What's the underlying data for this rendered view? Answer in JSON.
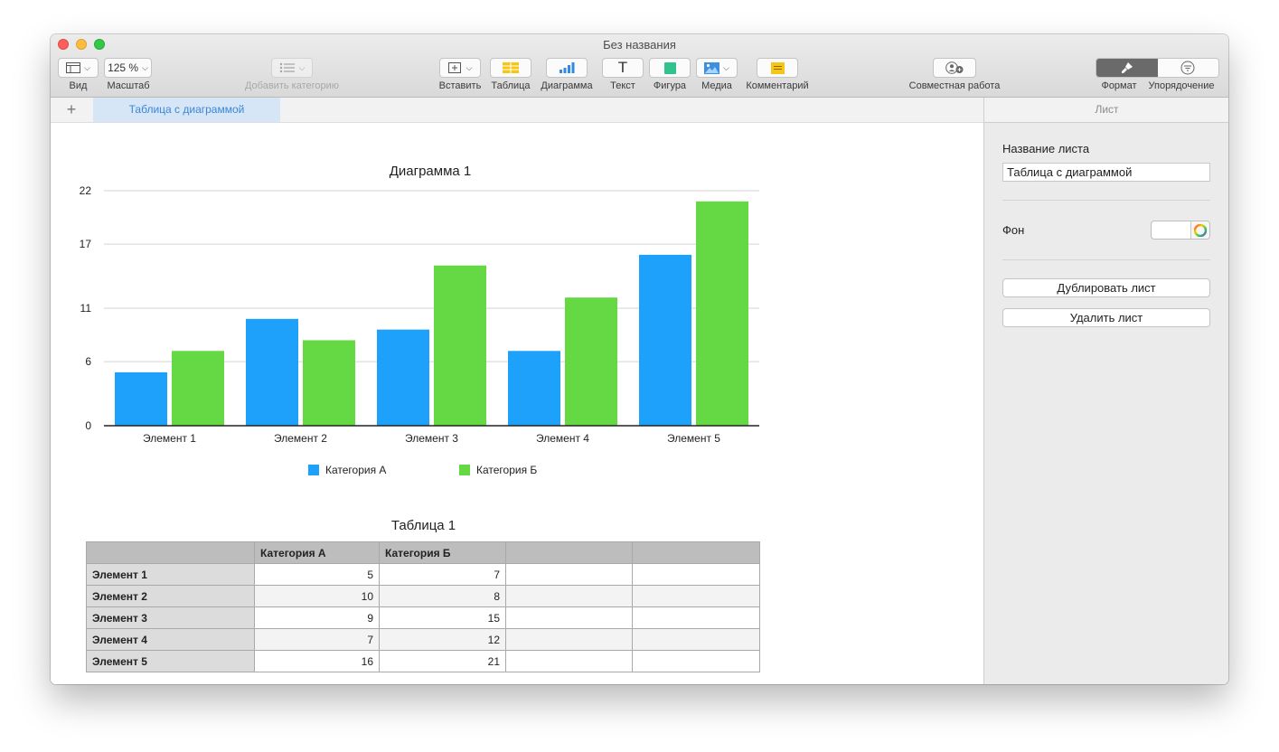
{
  "window": {
    "title": "Без названия"
  },
  "toolbar": {
    "view_label": "Вид",
    "zoom_value": "125 %",
    "zoom_label": "Масштаб",
    "add_category_label": "Добавить категорию",
    "insert_label": "Вставить",
    "table_label": "Таблица",
    "chart_label": "Диаграмма",
    "text_label": "Текст",
    "text_icon_glyph": "T",
    "shape_label": "Фигура",
    "media_label": "Медиа",
    "comment_label": "Комментарий",
    "collab_label": "Совместная работа",
    "format_label": "Формат",
    "organize_label": "Упорядочение"
  },
  "tabs": {
    "add_symbol": "+",
    "active": "Таблица с диаграммой"
  },
  "sidebar": {
    "header": "Лист",
    "name_label": "Название листа",
    "name_value": "Таблица с диаграммой",
    "background_label": "Фон",
    "duplicate_button": "Дублировать лист",
    "delete_button": "Удалить лист"
  },
  "colors": {
    "series_a": "#1ea1fa",
    "series_b": "#64d944"
  },
  "chart_data": {
    "type": "bar",
    "title": "Диаграмма 1",
    "categories": [
      "Элемент 1",
      "Элемент 2",
      "Элемент 3",
      "Элемент 4",
      "Элемент 5"
    ],
    "series": [
      {
        "name": "Категория А",
        "values": [
          5,
          10,
          9,
          7,
          16
        ]
      },
      {
        "name": "Категория Б",
        "values": [
          7,
          8,
          15,
          12,
          21
        ]
      }
    ],
    "yticks": [
      0,
      6,
      11,
      17,
      22
    ],
    "ylim": [
      0,
      22
    ],
    "grid": true,
    "legend": "bottom"
  },
  "table": {
    "title": "Таблица 1",
    "header": [
      "",
      "Категория А",
      "Категория Б",
      "",
      ""
    ],
    "rows": [
      {
        "label": "Элемент 1",
        "a": "5",
        "b": "7"
      },
      {
        "label": "Элемент 2",
        "a": "10",
        "b": "8"
      },
      {
        "label": "Элемент 3",
        "a": "9",
        "b": "15"
      },
      {
        "label": "Элемент 4",
        "a": "7",
        "b": "12"
      },
      {
        "label": "Элемент 5",
        "a": "16",
        "b": "21"
      }
    ]
  }
}
